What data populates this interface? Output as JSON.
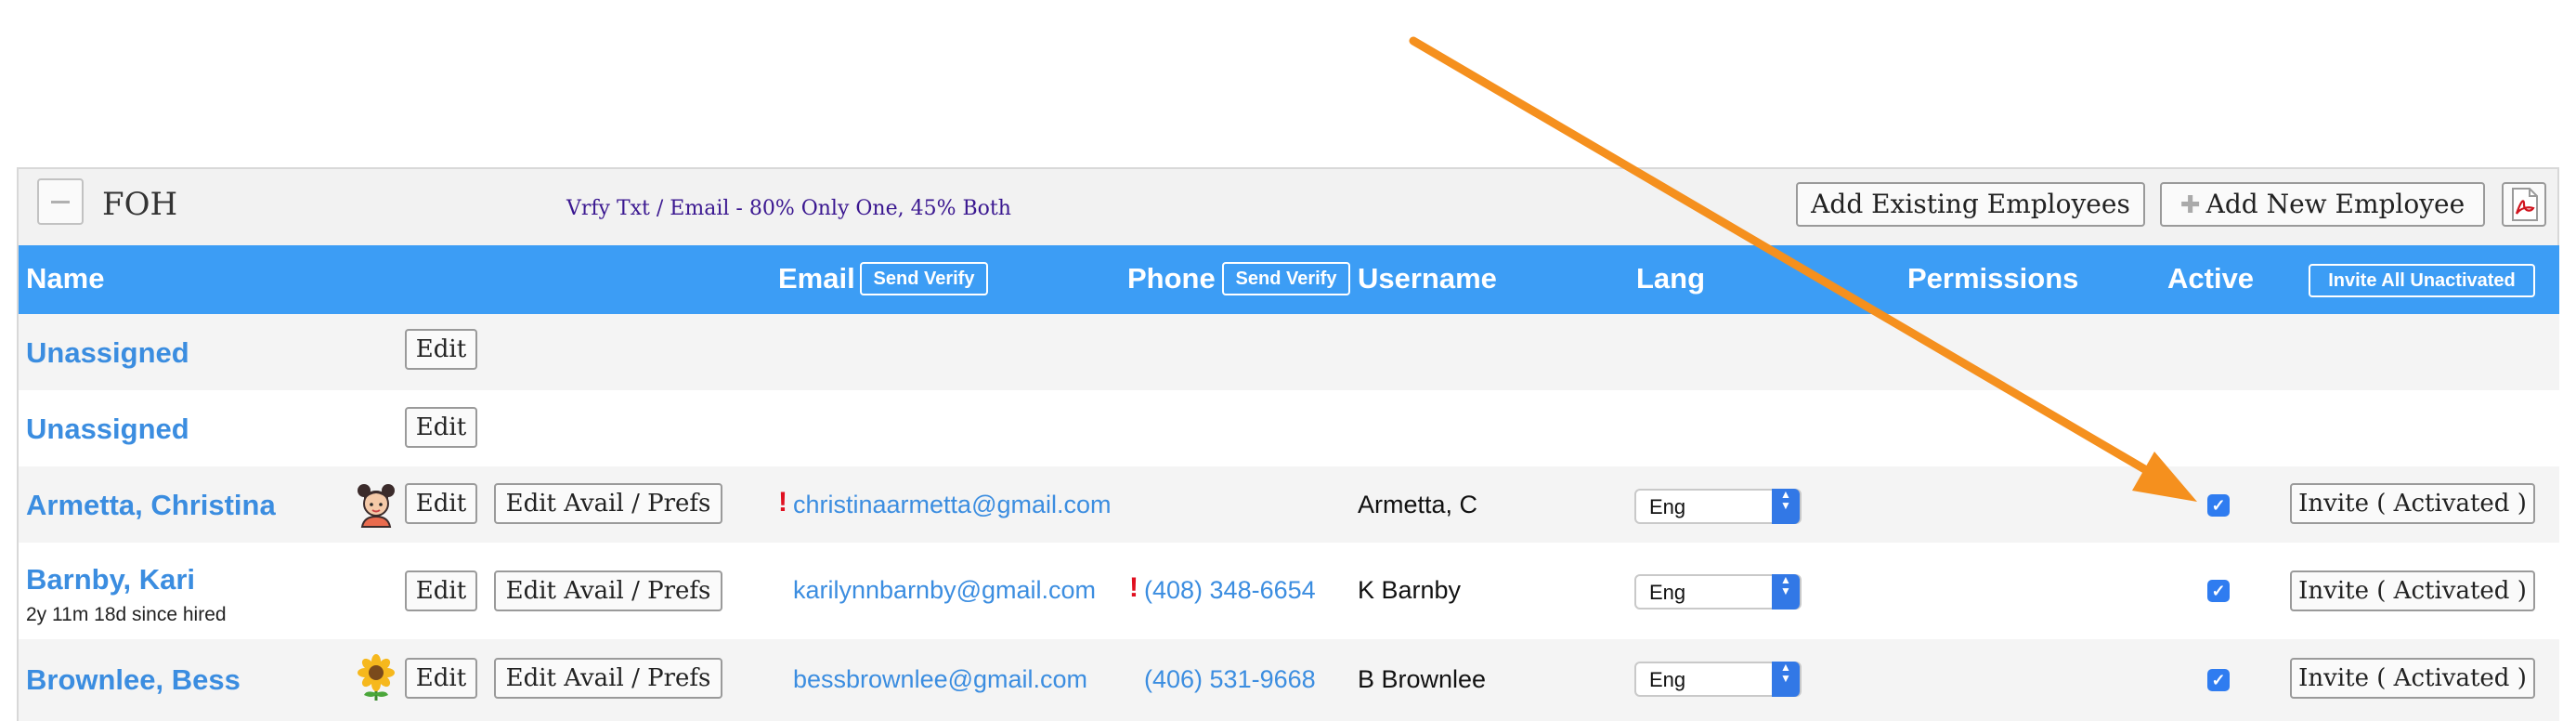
{
  "panel": {
    "group_title": "FOH",
    "verify_note": "Vrfy Txt / Email - 80% Only One, 45% Both",
    "add_existing_label": "Add Existing Employees",
    "add_new_label": "Add New Employee",
    "add_new_icon": "plus-icon",
    "pdf_icon": "pdf-icon",
    "collapse_icon": "minus-icon"
  },
  "columns": {
    "name": "Name",
    "email": "Email",
    "email_action": "Send Verify",
    "phone": "Phone",
    "phone_action": "Send Verify",
    "username": "Username",
    "lang": "Lang",
    "permissions": "Permissions",
    "active": "Active",
    "invite_all": "Invite All Unactivated"
  },
  "rows": [
    {
      "name": "Unassigned",
      "edit": "Edit"
    },
    {
      "name": "Unassigned",
      "edit": "Edit"
    },
    {
      "name": "Armetta, Christina",
      "avatar_icon": "girl-avatar-icon",
      "edit": "Edit",
      "edit_avail": "Edit Avail / Prefs",
      "email_warning": "!",
      "email": "christinaarmetta@gmail.com",
      "username": "Armetta, C",
      "lang": "Eng",
      "active": true,
      "invite": "Invite ( Activated )"
    },
    {
      "name": "Barnby, Kari",
      "tenure": "2y 11m 18d since hired",
      "edit": "Edit",
      "edit_avail": "Edit Avail / Prefs",
      "email": "karilynnbarnby@gmail.com",
      "phone_warning": "!",
      "phone": "(408) 348-6654",
      "username": "K Barnby",
      "lang": "Eng",
      "active": true,
      "invite": "Invite ( Activated )"
    },
    {
      "name": "Brownlee, Bess",
      "avatar_icon": "sunflower-icon",
      "edit": "Edit",
      "edit_avail": "Edit Avail / Prefs",
      "email": "bessbrownlee@gmail.com",
      "phone": "(406) 531-9668",
      "username": "B Brownlee",
      "lang": "Eng",
      "active": true,
      "invite": "Invite ( Activated )"
    }
  ],
  "annotation": {
    "arrow_color": "#f5901e"
  },
  "colors": {
    "header_blue": "#3c9df5",
    "link_blue": "#3b8de0",
    "warning_red": "#e01020"
  }
}
